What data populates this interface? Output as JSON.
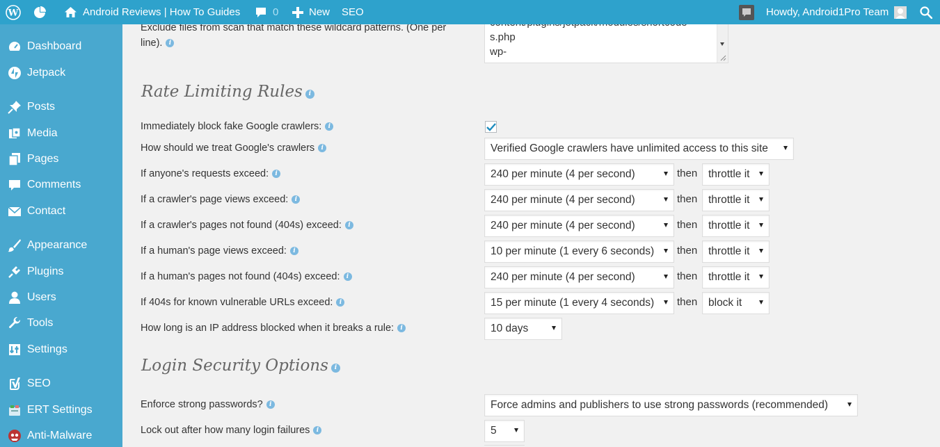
{
  "adminbar": {
    "site_name": "Android Reviews | How To Guides",
    "comments_count": "0",
    "new_label": "New",
    "seo_label": "SEO",
    "greeting": "Howdy, Android1Pro Team"
  },
  "sidebar": {
    "items": [
      {
        "label": "Dashboard",
        "icon": "dashboard-icon"
      },
      {
        "label": "Jetpack",
        "icon": "jetpack-icon"
      },
      {
        "label": "Posts",
        "icon": "pin-icon"
      },
      {
        "label": "Media",
        "icon": "media-icon"
      },
      {
        "label": "Pages",
        "icon": "pages-icon"
      },
      {
        "label": "Comments",
        "icon": "comment-icon"
      },
      {
        "label": "Contact",
        "icon": "mail-icon"
      },
      {
        "label": "Appearance",
        "icon": "brush-icon"
      },
      {
        "label": "Plugins",
        "icon": "plugin-icon"
      },
      {
        "label": "Users",
        "icon": "user-icon"
      },
      {
        "label": "Tools",
        "icon": "wrench-icon"
      },
      {
        "label": "Settings",
        "icon": "settings-icon"
      },
      {
        "label": "SEO",
        "icon": "yoast-icon"
      },
      {
        "label": "ERT Settings",
        "icon": "ert-icon"
      },
      {
        "label": "Anti-Malware",
        "icon": "anti-malware-icon"
      }
    ]
  },
  "exclude": {
    "label_line1": "Exclude files from scan that match these wildcard patterns. (One per",
    "label_line2": "line).",
    "textarea_lines": [
      "content/plugins/jetpack/modules/shortcode",
      "s.php",
      "wp-"
    ]
  },
  "rate_limiting": {
    "title": "Rate Limiting Rules",
    "then_label": "then",
    "rows": [
      {
        "label": "Immediately block fake Google crawlers:",
        "checked": true
      },
      {
        "label": "How should we treat Google's crawlers",
        "value": "Verified Google crawlers have unlimited access to this site"
      },
      {
        "label": "If anyone's requests exceed:",
        "value": "240 per minute (4 per second)",
        "action": "throttle it"
      },
      {
        "label": "If a crawler's page views exceed:",
        "value": "240 per minute (4 per second)",
        "action": "throttle it"
      },
      {
        "label": "If a crawler's pages not found (404s) exceed:",
        "value": "240 per minute (4 per second)",
        "action": "throttle it"
      },
      {
        "label": "If a human's page views exceed:",
        "value": "10 per minute (1 every 6 seconds)",
        "action": "throttle it"
      },
      {
        "label": "If a human's pages not found (404s) exceed:",
        "value": "240 per minute (4 per second)",
        "action": "throttle it"
      },
      {
        "label": "If 404s for known vulnerable URLs exceed:",
        "value": "15 per minute (1 every 4 seconds)",
        "action": "block it"
      },
      {
        "label": "How long is an IP address blocked when it breaks a rule:",
        "value": "10 days"
      }
    ]
  },
  "login_security": {
    "title": "Login Security Options",
    "rows": [
      {
        "label": "Enforce strong passwords?",
        "value": "Force admins and publishers to use strong passwords (recommended)"
      },
      {
        "label": "Lock out after how many login failures",
        "value": "5"
      }
    ]
  },
  "colors": {
    "adminbar": "#2ea2cc",
    "sidebar": "#49a8cf",
    "content_bg": "#f1f1f1"
  }
}
